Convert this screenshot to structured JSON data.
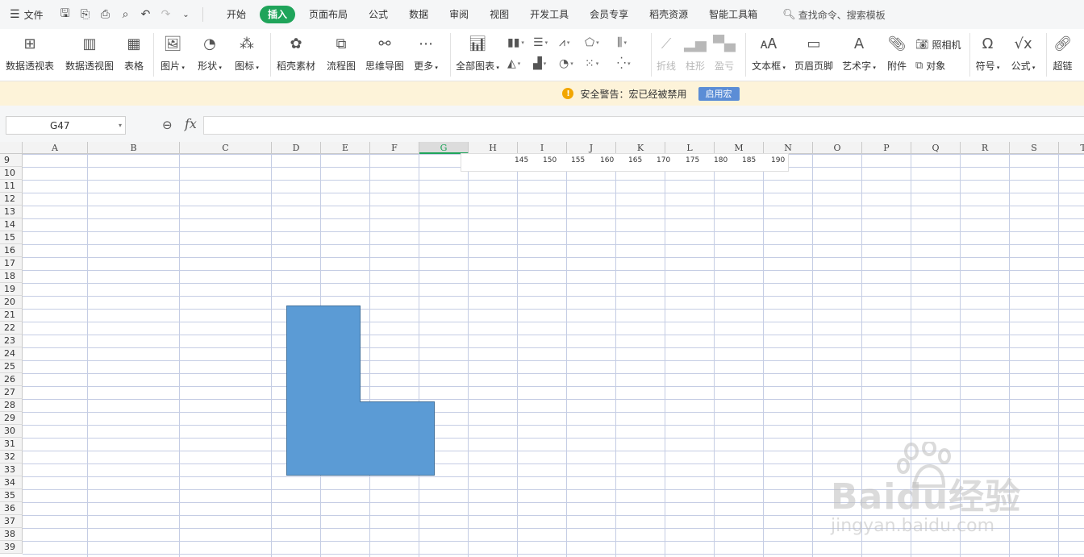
{
  "menubar": {
    "file_label": "文件",
    "tabs": [
      "开始",
      "插入",
      "页面布局",
      "公式",
      "数据",
      "审阅",
      "视图",
      "开发工具",
      "会员专享",
      "稻壳资源",
      "智能工具箱"
    ],
    "active_tab": "插入",
    "search_placeholder": "查找命令、搜索模板"
  },
  "ribbon": {
    "pivot_table": "数据透视表",
    "pivot_chart": "数据透视图",
    "table": "表格",
    "picture": "图片",
    "shape": "形状",
    "icon": "图标",
    "docer_material": "稻壳素材",
    "flowchart": "流程图",
    "mindmap": "思维导图",
    "more": "更多",
    "all_charts": "全部图表",
    "sparkline_line": "折线",
    "sparkline_column": "柱形",
    "sparkline_winloss": "盈亏",
    "textbox": "文本框",
    "header_footer": "页眉页脚",
    "wordart": "艺术字",
    "attachment": "附件",
    "camera": "照相机",
    "object": "对象",
    "symbol": "符号",
    "formula": "公式",
    "hyperlink": "超链"
  },
  "warning": {
    "text": "安全警告：宏已经被禁用",
    "button": "启用宏"
  },
  "formula_bar": {
    "cell_ref": "G47",
    "fx_label": "fx",
    "value": ""
  },
  "sheet": {
    "columns": [
      "A",
      "B",
      "C",
      "D",
      "E",
      "F",
      "G",
      "H",
      "I",
      "J",
      "K",
      "L",
      "M",
      "N",
      "O",
      "P",
      "Q",
      "R",
      "S",
      "T"
    ],
    "selected_column": "G",
    "rows": [
      "9",
      "10",
      "11",
      "12",
      "13",
      "14",
      "15",
      "16",
      "17",
      "18",
      "19",
      "20",
      "21",
      "22",
      "23",
      "24",
      "25",
      "26",
      "27",
      "28",
      "29",
      "30",
      "31",
      "32",
      "33",
      "34",
      "35",
      "36",
      "37",
      "38",
      "39"
    ],
    "axis_ticks": [
      "145",
      "150",
      "155",
      "160",
      "165",
      "170",
      "175",
      "180",
      "185",
      "190"
    ],
    "shape_fill": "#5b9bd5",
    "shape_stroke": "#41719c"
  },
  "watermark": {
    "main": "Baidu经验",
    "sub": "jingyan.baidu.com"
  }
}
